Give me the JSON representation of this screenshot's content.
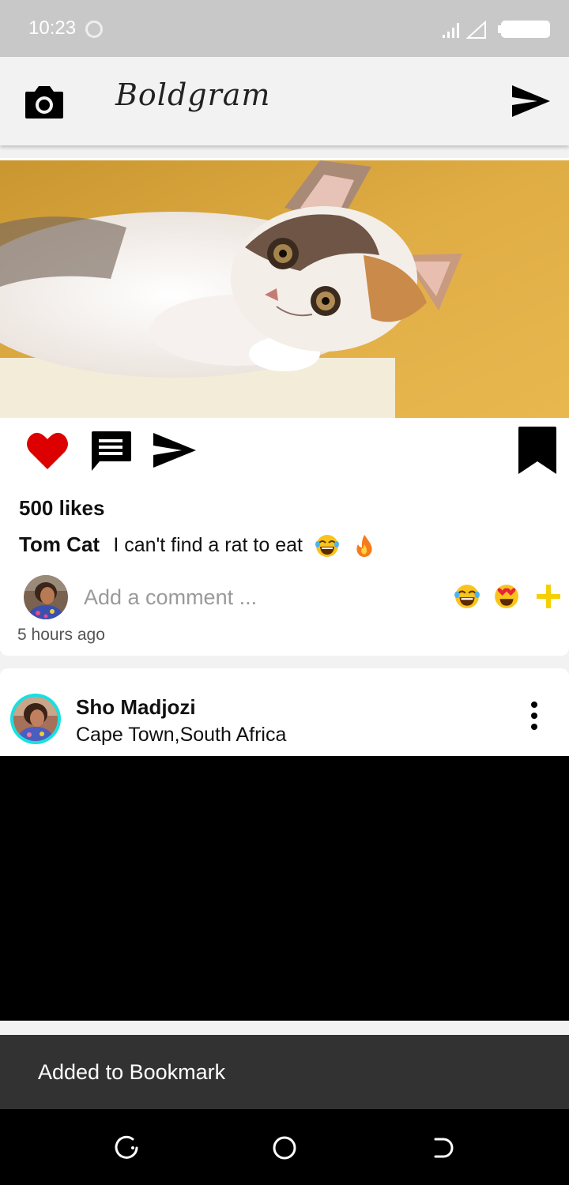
{
  "status_bar": {
    "time": "10:23"
  },
  "app_bar": {
    "title": "Boldgram",
    "camera_icon": "camera-icon",
    "send_icon": "send-icon"
  },
  "post": {
    "image_icon": "kitten-photo",
    "likes": "500 likes",
    "author": "Tom Cat",
    "caption": "I can't find a rat to eat",
    "caption_emojis": [
      "laughing-face-emoji",
      "fire-emoji"
    ],
    "comment_placeholder": "Add a comment ...",
    "quick_reactions": [
      "laughing-face-emoji",
      "heart-eyes-emoji"
    ],
    "time_ago": "5 hours ago"
  },
  "post2": {
    "author": "Sho Madjozi",
    "location": "Cape Town,South Africa"
  },
  "snackbar": {
    "message": "Added to Bookmark"
  },
  "colors": {
    "like": "#dd0000",
    "avatar_ring": "#19e0e0",
    "add_reaction": "#f5d000",
    "snackbar": "#323232"
  }
}
